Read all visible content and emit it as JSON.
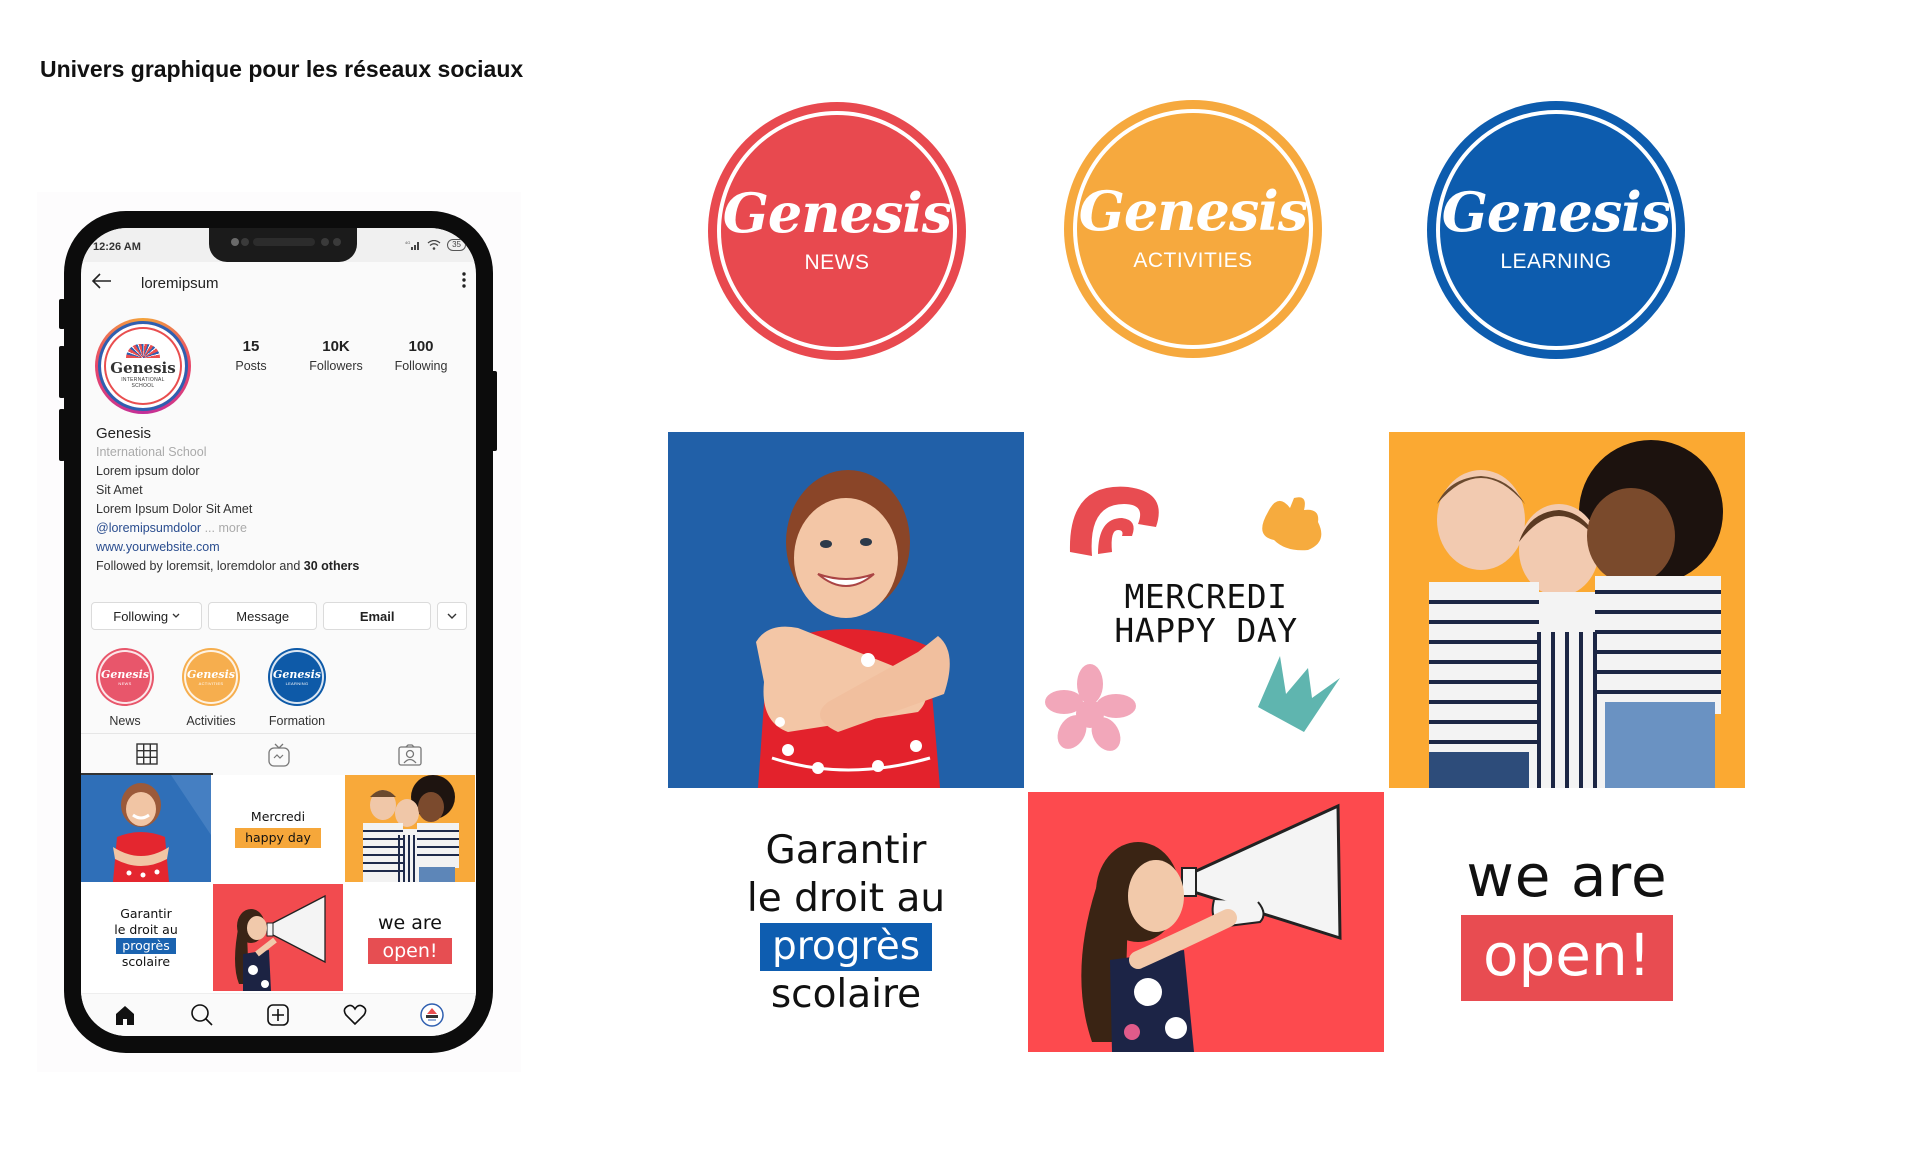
{
  "page": {
    "title": "Univers graphique pour les réseaux sociaux"
  },
  "colors": {
    "red": "#e84c51",
    "orange": "#f6a93e",
    "blue": "#0d5cae",
    "tile_blue": "#2160a8",
    "tile_orange": "#fba932",
    "tile_red": "#fd4a4e"
  },
  "phone": {
    "status_bar": {
      "time": "12:26 AM",
      "network": "4G",
      "battery": "35"
    },
    "header": {
      "back_icon": "arrow-left-icon",
      "username": "loremipsum",
      "menu_icon": "more-vertical-icon"
    },
    "avatar": {
      "brand": "Genesis",
      "subtitle_line1": "INTERNATIONAL",
      "subtitle_line2": "SCHOOL"
    },
    "stats": [
      {
        "value": "15",
        "label": "Posts"
      },
      {
        "value": "10K",
        "label": "Followers"
      },
      {
        "value": "100",
        "label": "Following"
      }
    ],
    "bio": {
      "name": "Genesis",
      "category": "International School",
      "lines": [
        "Lorem ipsum dolor",
        "Sit Amet",
        "Lorem Ipsum Dolor Sit Amet"
      ],
      "mention": "@loremipsumdolor",
      "more": "... more",
      "website": "www.yourwebsite.com",
      "followed_prefix": "Followed by ",
      "followed_names": "loremsit, loremdolor",
      "followed_and": " and ",
      "followed_others": "30 others"
    },
    "actions": {
      "following": "Following",
      "message": "Message",
      "email": "Email"
    },
    "highlights": [
      {
        "brand": "Genesis",
        "sub": "NEWS",
        "label": "News",
        "color": "#e8566b"
      },
      {
        "brand": "Genesis",
        "sub": "ACTIVITIES",
        "label": "Activities",
        "color": "#f6ae4e"
      },
      {
        "brand": "Genesis",
        "sub": "LEARNING",
        "label": "Formation",
        "color": "#0e5aa8"
      }
    ],
    "tabs": [
      "grid-icon",
      "igtv-icon",
      "tagged-icon"
    ],
    "grid": {
      "mercredi": "Mercredi",
      "happy_day": "happy day",
      "garantir": "Garantir",
      "droit": "le droit au",
      "progres": "progrès",
      "scolaire": "scolaire",
      "we_are": "we are",
      "open": "open!"
    },
    "bottom_nav": [
      "home-icon",
      "search-icon",
      "add-post-icon",
      "activity-heart-icon",
      "profile-icon"
    ]
  },
  "logos": [
    {
      "brand": "Genesis",
      "sub": "NEWS",
      "color": "#e8494f"
    },
    {
      "brand": "Genesis",
      "sub": "ACTIVITIES",
      "color": "#f6a93e"
    },
    {
      "brand": "Genesis",
      "sub": "LEARNING",
      "color": "#0d5cae"
    }
  ],
  "tiles": {
    "mercredi_line1": "MERCREDI",
    "mercredi_line2": "HAPPY DAY",
    "garantir": "Garantir",
    "droit": "le droit au",
    "progres": "progrès",
    "scolaire": "scolaire",
    "we_are": "we are",
    "open": "open!"
  }
}
